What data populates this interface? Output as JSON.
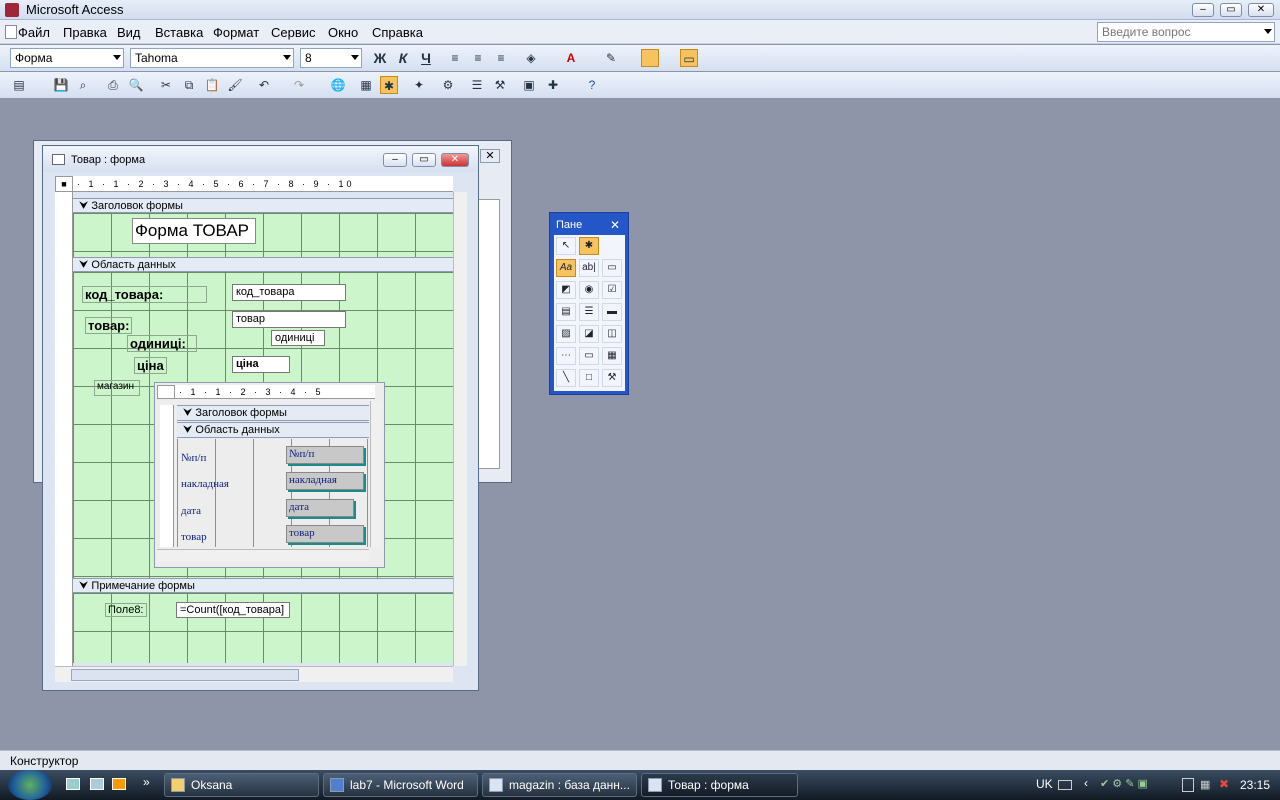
{
  "app": {
    "title": "Microsoft Access"
  },
  "menu": [
    "Файл",
    "Правка",
    "Вид",
    "Вставка",
    "Формат",
    "Сервис",
    "Окно",
    "Справка"
  ],
  "help": {
    "placeholder": "Введите вопрос"
  },
  "format_toolbar": {
    "object": "Форма",
    "font": "Tahoma",
    "size": "8",
    "bold": "Ж",
    "italic": "К",
    "underline": "Ч"
  },
  "form_window": {
    "title": "Товар : форма"
  },
  "ruler": {
    "h": "· 1 · 1 · 2 · 3 · 4 · 5 · 6 · 7 · 8 · 9 · 10",
    "sub": "· 1 · 1 · 2 · 3 · 4 · 5"
  },
  "sections": {
    "header": "Заголовок формы",
    "detail": "Область данных",
    "footer": "Примечание формы"
  },
  "form": {
    "title": "Форма ТОВАР",
    "labels": {
      "kod": "код_товара:",
      "tovar": "товар:",
      "odynytsi": "одиниці:",
      "tsina": "ціна",
      "magazin": "магазин",
      "pole8": "Поле8:"
    },
    "fields": {
      "kod": "код_товара",
      "tovar": "товар",
      "odynytsi": "одиниці",
      "tsina": "ціна",
      "count": "=Count([код_товара]"
    }
  },
  "subform": {
    "header": "Заголовок формы",
    "detail": "Область данных",
    "rows": [
      {
        "label": "№п/п",
        "field": "№п/п"
      },
      {
        "label": "накладная",
        "field": "накладная"
      },
      {
        "label": "дата",
        "field": "дата"
      },
      {
        "label": "товар",
        "field": "товар"
      }
    ]
  },
  "toolbox": {
    "title": "Пане"
  },
  "status": {
    "text": "Конструктор"
  },
  "taskbar": {
    "items": [
      {
        "label": "Oksana"
      },
      {
        "label": "lab7 - Microsoft Word"
      },
      {
        "label": "magazin : база данн..."
      },
      {
        "label": "Товар : форма"
      }
    ],
    "lang": "UK",
    "time": "23:15"
  }
}
